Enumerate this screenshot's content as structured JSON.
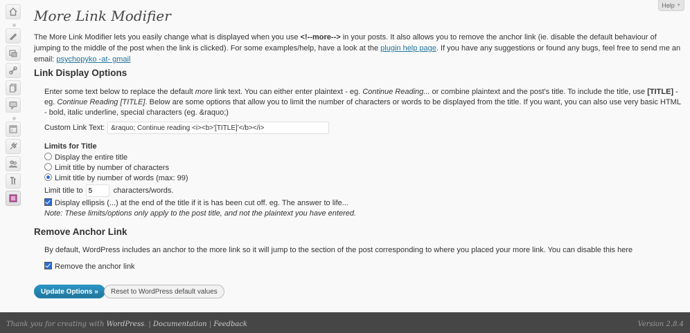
{
  "help_tab": {
    "label": "Help"
  },
  "page": {
    "title": "More Link Modifier",
    "intro": {
      "part1": "The More Link Modifier lets you easily change what is displayed when you use ",
      "code_open": "<!--",
      "code_bold": "more",
      "code_close": "-->",
      "part2": " in your posts. It also allows you to remove the anchor link (ie. disable the default behaviour of jumping to the middle of the post when the link is clicked). For some examples/help, have a look at the ",
      "help_link": "plugin help page",
      "part3": ". If you have any suggestions or found any bugs, feel free to send me an email: ",
      "email_link": "psychopyko -at- gmail"
    }
  },
  "link_display": {
    "heading": "Link Display Options",
    "desc": {
      "p1": "Enter some text below to replace the default ",
      "more": "more",
      "p2": " link text. You can either enter plaintext - eg. ",
      "ex1": "Continue Reading...",
      "p3": " or combine plaintext and the post's title. To include the title, use ",
      "token": "[TITLE]",
      "p4": " - eg. ",
      "ex2": "Continue Reading [TITLE]",
      "p5": ". Below are some options that allow you to limit the number of characters or words to be displayed from the title. If you want, you can also use very basic HTML - bold, italic underline, special characters (eg. &raquo;)"
    },
    "custom_label": "Custom Link Text:",
    "custom_value": "&raquo; Continue reading <i><b>'[TITLE]'</b></i>",
    "limits_heading": "Limits for Title",
    "options": [
      {
        "label": "Display the entire title",
        "checked": false
      },
      {
        "label": "Limit title by number of characters",
        "checked": false
      },
      {
        "label": "Limit title by number of words (max: 99)",
        "checked": true
      }
    ],
    "limit_label": "Limit title to",
    "limit_value": "5",
    "limit_unit": "characters/words.",
    "ellipsis_label": "Display ellipsis (...) at the end of the title if it is has been cut off. eg. The answer to life...",
    "ellipsis_checked": true,
    "note": "Note: These limits/options only apply to the post title, and not the plaintext you have entered."
  },
  "remove_anchor": {
    "heading": "Remove Anchor Link",
    "desc": "By default, WordPress includes an anchor to the more link so it will jump to the section of the post corresponding to where you placed your more link. You can disable this here",
    "checkbox_label": "Remove the anchor link",
    "checked": true
  },
  "buttons": {
    "update": "Update Options »",
    "reset": "Reset to WordPress default values"
  },
  "footer": {
    "thanks_prefix": "Thank you for creating with ",
    "wordpress": "WordPress",
    "sep1": ". | ",
    "documentation": "Documentation",
    "sep2": " | ",
    "feedback": "Feedback",
    "version": "Version 2.8.4"
  },
  "menu_icons": [
    "dashboard-icon",
    "posts-icon",
    "media-icon",
    "links-icon",
    "pages-icon",
    "comments-icon",
    "appearance-icon",
    "plugins-icon",
    "users-icon",
    "tools-icon",
    "settings-icon"
  ]
}
